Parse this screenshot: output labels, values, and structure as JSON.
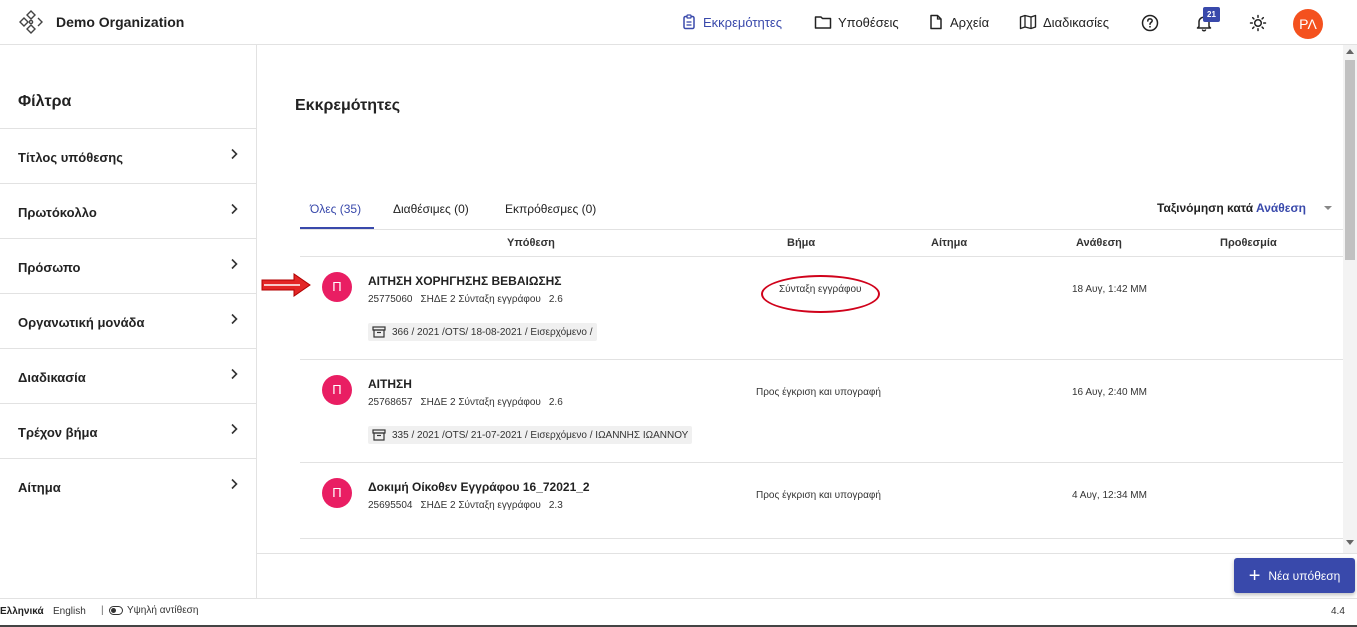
{
  "header": {
    "org_name": "Demo Organization",
    "nav": [
      {
        "label": "Εκκρεμότητες",
        "icon": "clipboard-icon",
        "active": true
      },
      {
        "label": "Υποθέσεις",
        "icon": "folder-icon"
      },
      {
        "label": "Αρχεία",
        "icon": "file-icon"
      },
      {
        "label": "Διαδικασίες",
        "icon": "map-icon"
      }
    ],
    "notifications_count": "21",
    "user_initials": "ΡΛ"
  },
  "sidebar": {
    "title": "Φίλτρα",
    "items": [
      {
        "label": "Τίτλος υπόθεσης"
      },
      {
        "label": "Πρωτόκολλο"
      },
      {
        "label": "Πρόσωπο"
      },
      {
        "label": "Οργανωτική μονάδα"
      },
      {
        "label": "Διαδικασία"
      },
      {
        "label": "Τρέχον βήμα"
      },
      {
        "label": "Αίτημα"
      }
    ]
  },
  "main": {
    "title": "Εκκρεμότητες",
    "tabs": [
      {
        "label": "Όλες (35)",
        "active": true
      },
      {
        "label": "Διαθέσιμες (0)"
      },
      {
        "label": "Εκπρόθεσμες (0)"
      }
    ],
    "sort": {
      "prefix": "Ταξινόμηση κατά",
      "value": "Ανάθεση"
    },
    "columns": {
      "case": "Υπόθεση",
      "step": "Βήμα",
      "request": "Αίτημα",
      "assignment": "Ανάθεση",
      "deadline": "Προθεσμία"
    },
    "rows": [
      {
        "avatar": "Π",
        "title": "ΑΙΤΗΣΗ ΧΟΡΗΓΗΣΗΣ ΒΕΒΑΙΩΣΗΣ",
        "id": "25775060",
        "meta": "ΣΗΔΕ 2 Σύνταξη εγγράφου",
        "version": "2.6",
        "protocol": "366 / 2021 /OTS/ 18-08-2021 / Εισερχόμενο /",
        "step": "Σύνταξη εγγράφου",
        "assignment": "18 Αυγ, 1:42 ΜΜ"
      },
      {
        "avatar": "Π",
        "title": "ΑΙΤΗΣΗ",
        "id": "25768657",
        "meta": "ΣΗΔΕ 2 Σύνταξη εγγράφου",
        "version": "2.6",
        "protocol": "335 / 2021 /OTS/ 21-07-2021 / Εισερχόμενο / ΙΩΑΝΝΗΣ ΙΩΑΝΝΟΥ",
        "step": "Προς έγκριση και υπογραφή",
        "assignment": "16 Αυγ, 2:40 ΜΜ"
      },
      {
        "avatar": "Π",
        "title": "Δοκιμή Οίκοθεν Εγγράφου 16_72021_2",
        "id": "25695504",
        "meta": "ΣΗΔΕ 2 Σύνταξη εγγράφου",
        "version": "2.3",
        "step": "Προς έγκριση και υπογραφή",
        "assignment": "4 Αυγ, 12:34 ΜΜ"
      }
    ],
    "new_button": "Νέα υπόθεση"
  },
  "footer": {
    "lang_el": "Ελληνικά",
    "lang_en": "English",
    "separator": "|",
    "high_contrast": "Υψηλή αντίθεση",
    "version": "4.4"
  },
  "colors": {
    "accent": "#3949ab",
    "avatar_case": "#e91e63",
    "avatar_user": "#f4511e",
    "annotation": "#d0021b"
  }
}
